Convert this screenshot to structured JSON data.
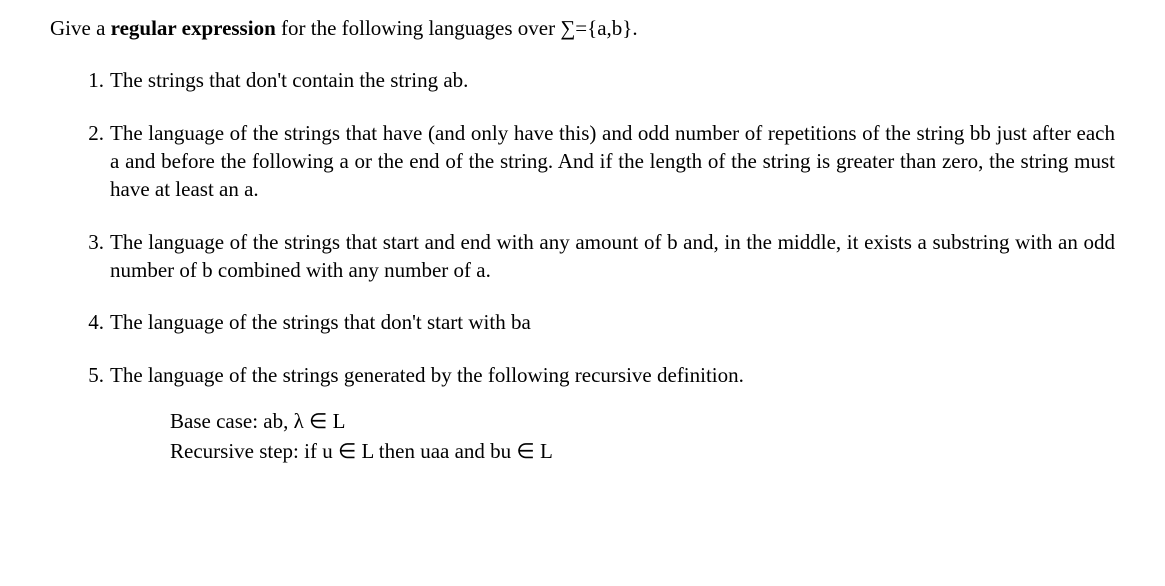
{
  "prompt": {
    "before_bold": "Give a ",
    "bold": "regular expression",
    "after_bold": " for the following languages over ∑={a,b}."
  },
  "questions": [
    {
      "num": "1.",
      "text": "The strings that don't contain the string ab."
    },
    {
      "num": "2.",
      "text": "The language of the strings that have (and only have this) and odd number of repetitions of the string bb just after each a and before the following a or the end of the string. And if the length of the string is greater than zero, the string must have at least an a."
    },
    {
      "num": "3.",
      "text": "The language of the strings that start and end with any amount of b and, in the middle, it exists a substring with an odd number of b combined with any number of a."
    },
    {
      "num": "4.",
      "text": "The language of the strings that don't start with ba"
    },
    {
      "num": "5.",
      "text": "The language of the strings generated by the following recursive definition."
    }
  ],
  "definition": {
    "base": "Base case: ab, λ ∈ L",
    "recursive": "Recursive step: if u ∈ L then uaa and bu ∈ L"
  }
}
